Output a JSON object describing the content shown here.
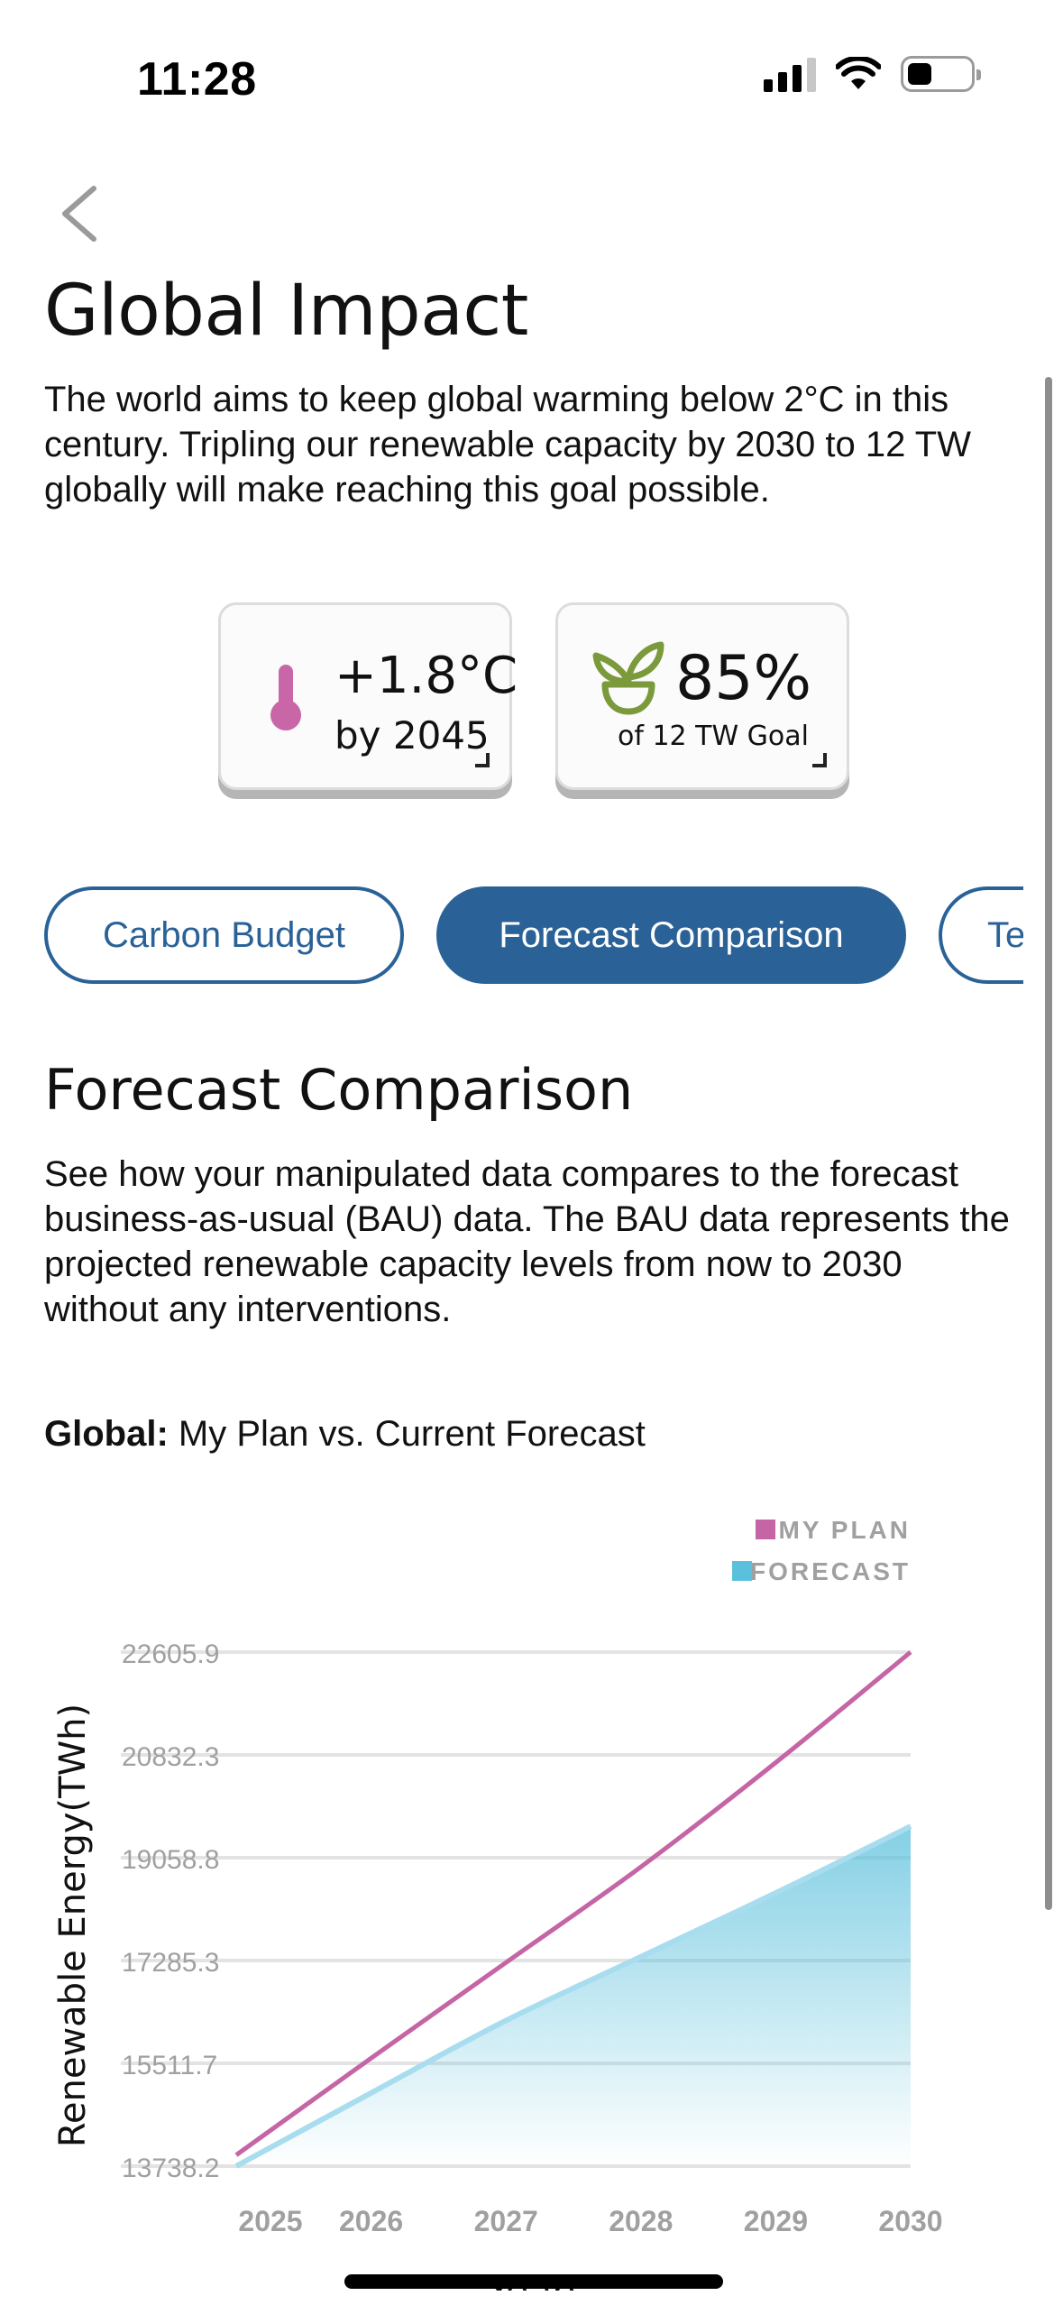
{
  "status_bar": {
    "time": "11:28"
  },
  "header": {
    "title": "Global Impact",
    "intro": "The world aims to keep global warming below 2°C in this century. Tripling our renewable capacity by 2030 to 12 TW globally will make reaching this goal possible."
  },
  "stats": {
    "temperature": {
      "value": "+1.8°C",
      "label": "by 2045",
      "icon": "thermometer-icon",
      "color": "#c966a8"
    },
    "goal": {
      "value": "85%",
      "label": "of 12 TW Goal",
      "icon": "plant-icon",
      "color": "#7a9a3c"
    }
  },
  "tabs": [
    {
      "label": "Carbon Budget",
      "active": false
    },
    {
      "label": "Forecast Comparison",
      "active": true
    },
    {
      "label": "Te",
      "active": false
    }
  ],
  "section": {
    "title": "Forecast Comparison",
    "description": "See how your manipulated data compares to the forecast business-as-usual (BAU) data. The BAU data represents the projected renewable capacity levels from now to 2030 without any interventions.",
    "chart_heading_bold": "Global:",
    "chart_heading_rest": " My Plan vs. Current Forecast"
  },
  "chart_data": {
    "type": "line",
    "title": "",
    "xlabel": "Years",
    "ylabel": "Renewable Energy(TWh)",
    "x": [
      2025,
      2026,
      2027,
      2028,
      2029,
      2030
    ],
    "x_tick_labels": [
      "2025",
      "2026",
      "2027",
      "2028",
      "2029",
      "2030"
    ],
    "y_tick_labels": [
      "22605.9",
      "20832.3",
      "19058.8",
      "17285.3",
      "15511.7",
      "13738.2"
    ],
    "y_ticks": [
      22605.9,
      20832.3,
      19058.8,
      17285.3,
      15511.7,
      13738.2
    ],
    "ylim": [
      13738.2,
      22605.9
    ],
    "grid": true,
    "legend_position": "top-right",
    "series": [
      {
        "name": "MY PLAN",
        "color": "#c565a6",
        "values": [
          13930,
          15600,
          17250,
          18900,
          20700,
          22605.9
        ]
      },
      {
        "name": "FORECAST",
        "color": "#5bc0dc",
        "values": [
          13738.2,
          15000,
          16250,
          17350,
          18450,
          19600
        ],
        "fill": true
      }
    ]
  },
  "colors": {
    "accent": "#2a6298",
    "my_plan": "#c565a6",
    "forecast": "#5bc0dc"
  }
}
